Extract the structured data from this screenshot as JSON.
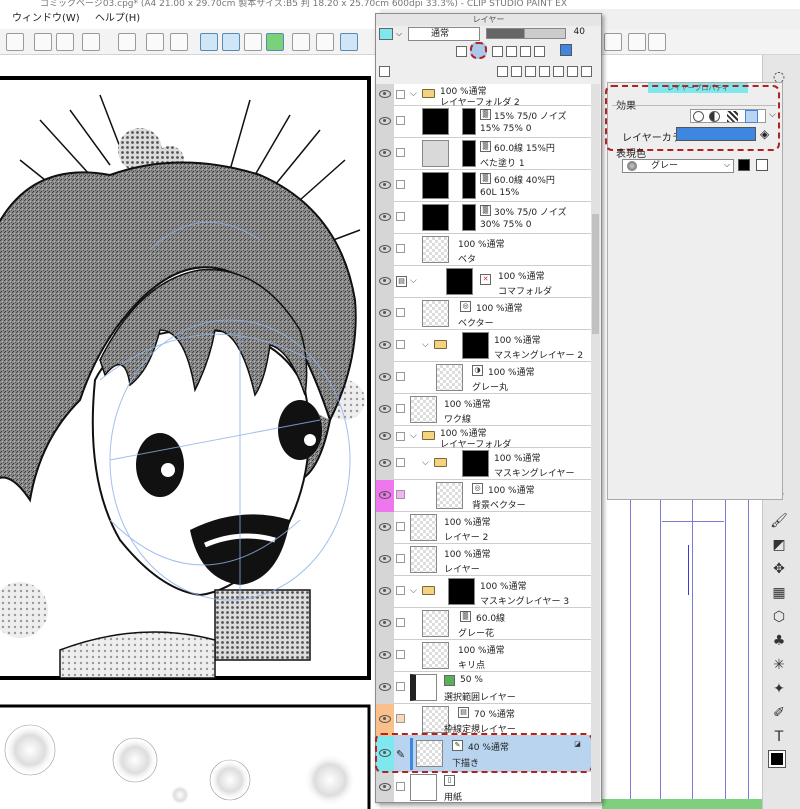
{
  "app": {
    "title": "コミックページ03.cpg* (A4 21.00 x 29.70cm 製本サイズ:B5 判 18.20 x 25.70cm 600dpi 33.3%) - CLIP STUDIO PAINT EX"
  },
  "menu": {
    "items": [
      "ウィンドウ(W)",
      "ヘルプ(H)"
    ]
  },
  "layer_panel": {
    "title": "レイヤー",
    "blend_mode": "通常",
    "opacity": "40",
    "layers": [
      {
        "line1": "100 %通常",
        "line2": "レイヤーフォルダ 2",
        "type": "folder",
        "indent": 0
      },
      {
        "line1": "15% 75/0 ノイズ",
        "line2": "15% 75% 0",
        "type": "tone",
        "indent": 1
      },
      {
        "line1": "60.0線 15%円",
        "line2": "べた塗り 1",
        "type": "tone",
        "indent": 1
      },
      {
        "line1": "60.0線 40%円",
        "line2": "60L 15%",
        "type": "tone",
        "indent": 1
      },
      {
        "line1": "30% 75/0 ノイズ",
        "line2": "30% 75% 0",
        "type": "tone",
        "indent": 1
      },
      {
        "line1": "100 %通常",
        "line2": "ベタ",
        "type": "raster",
        "indent": 1
      },
      {
        "line1": "100 %通常",
        "line2": "コマフォルダ",
        "type": "frame",
        "indent": 0
      },
      {
        "line1": "100 %通常",
        "line2": "ベクター",
        "type": "vector",
        "indent": 1
      },
      {
        "line1": "100 %通常",
        "line2": "マスキングレイヤー 2",
        "type": "folder",
        "indent": 1
      },
      {
        "line1": "100 %通常",
        "line2": "グレー丸",
        "type": "raster",
        "indent": 2
      },
      {
        "line1": "100 %通常",
        "line2": "ワク線",
        "type": "raster",
        "indent": 0
      },
      {
        "line1": "100 %通常",
        "line2": "レイヤーフォルダ",
        "type": "folder",
        "indent": 0
      },
      {
        "line1": "100 %通常",
        "line2": "マスキングレイヤー",
        "type": "folder",
        "indent": 1
      },
      {
        "line1": "100 %通常",
        "line2": "背景ベクター",
        "type": "vector",
        "indent": 2
      },
      {
        "line1": "100 %通常",
        "line2": "レイヤー 2",
        "type": "raster",
        "indent": 0
      },
      {
        "line1": "100 %通常",
        "line2": "レイヤー",
        "type": "raster",
        "indent": 0
      },
      {
        "line1": "100 %通常",
        "line2": "マスキングレイヤー 3",
        "type": "folder",
        "indent": 0
      },
      {
        "line1": "60.0線",
        "line2": "グレー花",
        "type": "tone",
        "indent": 1
      },
      {
        "line1": "100 %通常",
        "line2": "キリ点",
        "type": "raster",
        "indent": 1
      },
      {
        "line1": "50 %",
        "line2": "選択範囲レイヤー",
        "type": "selection",
        "indent": 0
      },
      {
        "line1": "70 %通常",
        "line2": "枠線定規レイヤー",
        "type": "raster",
        "indent": 0
      },
      {
        "line1": "40 %通常",
        "line2": "下描き",
        "type": "raster",
        "indent": 0,
        "selected": true
      },
      {
        "line1": "",
        "line2": "用紙",
        "type": "paper",
        "indent": 0
      }
    ]
  },
  "properties": {
    "title": "レイヤープロパティ",
    "effect_label": "効果",
    "layer_color_label": "レイヤーカラー",
    "expression_label": "表現色",
    "expression_value": "グレー"
  },
  "colors": {
    "layer_color": "#3f86e0",
    "accent_highlight": "#b22222",
    "selected_row": "#b8d4ee",
    "cyan_marker": "#7fe7ee",
    "magenta_marker": "#ee77ee",
    "orange_marker": "#f9c08c"
  }
}
